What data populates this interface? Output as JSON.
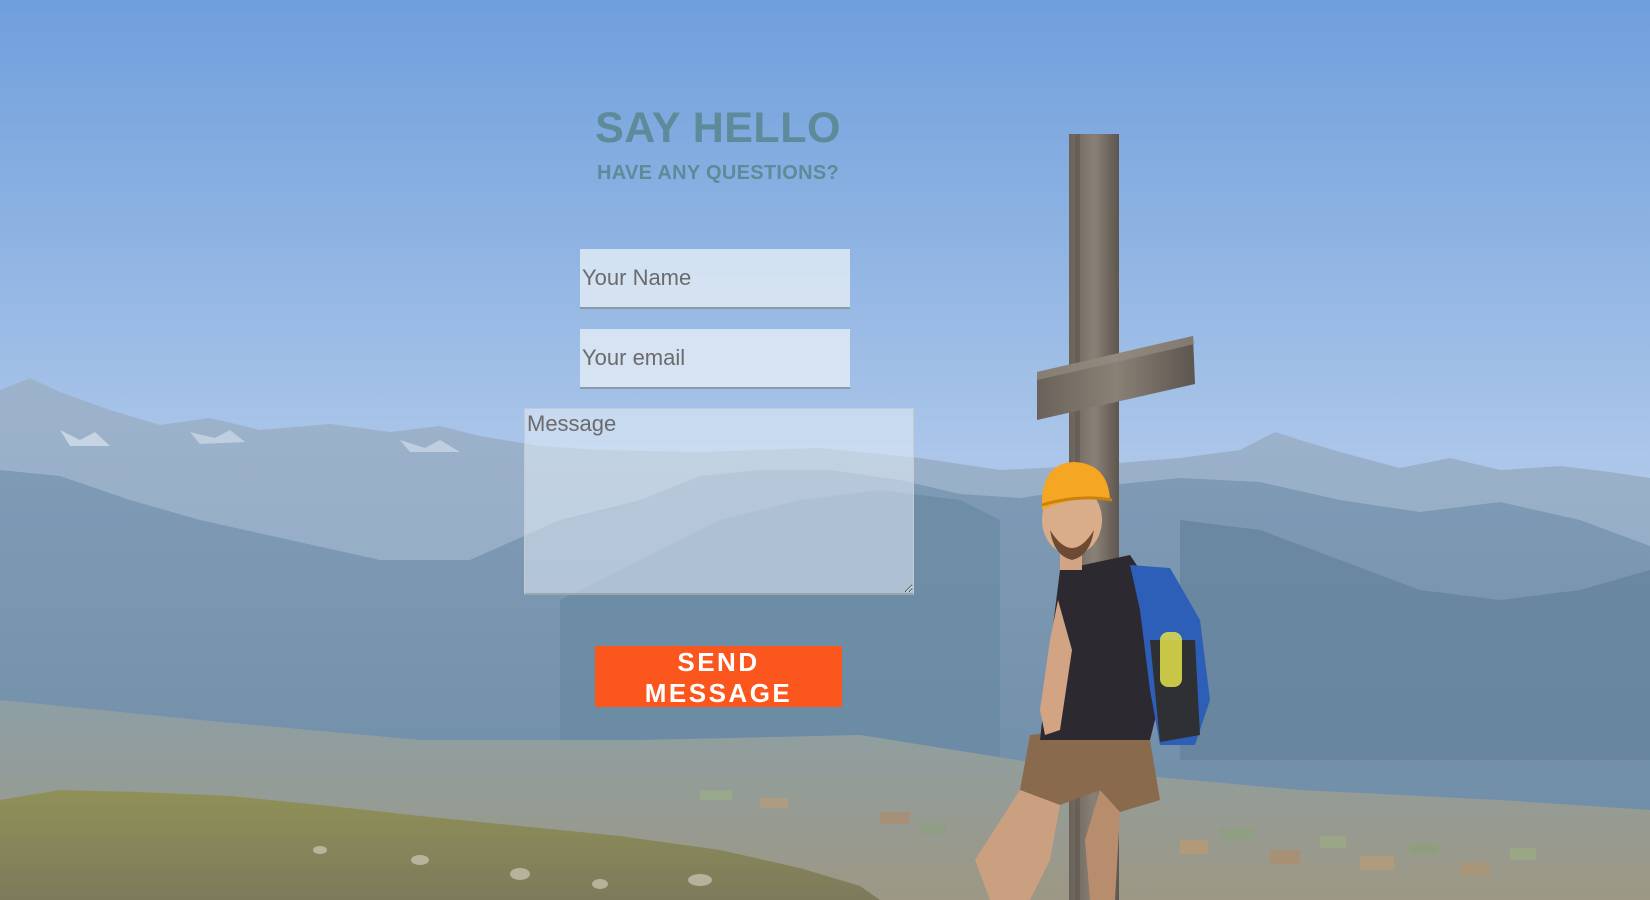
{
  "contact": {
    "title": "SAY HELLO",
    "subtitle": "HAVE ANY QUESTIONS?",
    "name_placeholder": "Your Name",
    "email_placeholder": "Your email",
    "message_placeholder": "Message",
    "send_label": "SEND MESSAGE"
  },
  "colors": {
    "heading": "#5e8a99",
    "button": "#fa561e",
    "sky_top": "#6f9fdc",
    "sky_bottom": "#b9d1ec"
  },
  "background": {
    "image": "mountain-summit-photo"
  }
}
